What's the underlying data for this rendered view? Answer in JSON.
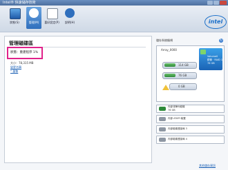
{
  "window": {
    "title": "Intel® 快速儲存技術"
  },
  "toolbar": {
    "buttons": [
      {
        "label": "狀態(S)",
        "icon": "monitor-icon"
      },
      {
        "label": "管理(M)",
        "icon": "gear-icon",
        "active": true
      },
      {
        "label": "喜好設定(P)",
        "icon": "document-icon"
      },
      {
        "label": "說明(H)",
        "icon": "help-icon"
      }
    ],
    "logo": "intel"
  },
  "left": {
    "title": "管理磁碟區",
    "status": "狀態：重建程序 1%",
    "size": "大小：78,315 MB",
    "link1": "變更名稱",
    "link2": "* 重整"
  },
  "right": {
    "title": "儲存系統檢視",
    "array_label": "Array_0000",
    "disks": [
      {
        "label": "114 GB"
      },
      {
        "label": "76 GB"
      },
      {
        "label": "0 GB"
      }
    ],
    "volume": {
      "name": "Volume0",
      "type": "鏡像 · RAID 1",
      "size": "76 GB"
    },
    "ports": [
      {
        "label": "內部非陣列磁碟",
        "sub": "76 GB"
      },
      {
        "label": "內部 ATAPI 裝置"
      },
      {
        "label": "內部磁碟連接埠 3"
      },
      {
        "label": "內部磁碟連接埠 4"
      }
    ]
  },
  "footer": {
    "more_link": "其他儲存資訊"
  },
  "colors": {
    "accent": "#1a6fc9",
    "highlight": "#e0218a"
  }
}
